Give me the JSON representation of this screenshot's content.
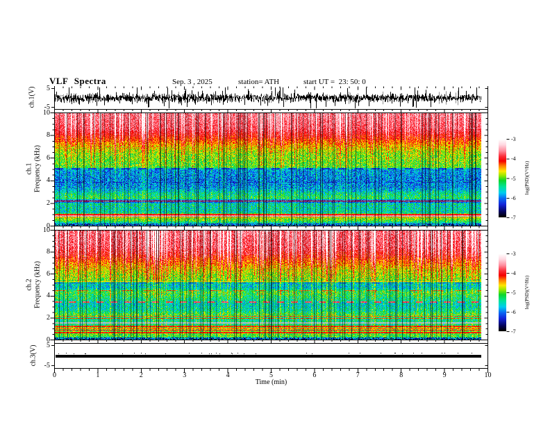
{
  "header": {
    "title": "VLF Spectra",
    "date": "Sep. 3 , 2025",
    "station": "station= ATH",
    "start_ut": "start UT =  23: 50: 0"
  },
  "axis": {
    "time_label": "Time (min)",
    "time_ticks": [
      "0",
      "1",
      "2",
      "3",
      "4",
      "5",
      "6",
      "7",
      "8",
      "9",
      "10"
    ],
    "freq_ticks": [
      "10",
      "8",
      "6",
      "4",
      "2",
      "0"
    ],
    "volt_ticks": [
      "5",
      "-5"
    ],
    "colorbar_ticks": [
      "-3",
      "-4",
      "-5",
      "-6",
      "-7"
    ],
    "colorbar_label": "log(PSD)(V²/Hz)"
  },
  "panel_labels": {
    "ch1_volt": "ch.1(V)",
    "ch1_name": "ch.1",
    "ch1_freq": "Frequency (kHz)",
    "ch2_name": "ch.2",
    "ch2_freq": "Frequency (kHz)",
    "ch3_volt": "ch.3(V)"
  },
  "colormap": {
    "stops": [
      [
        0,
        "#ffffff"
      ],
      [
        0.07,
        "#ffd9e2"
      ],
      [
        0.15,
        "#ff8d9e"
      ],
      [
        0.22,
        "#fb2e3a"
      ],
      [
        0.28,
        "#f40000"
      ],
      [
        0.34,
        "#ff7a00"
      ],
      [
        0.41,
        "#ffe800"
      ],
      [
        0.47,
        "#93e800"
      ],
      [
        0.53,
        "#0fd62a"
      ],
      [
        0.61,
        "#00e39a"
      ],
      [
        0.69,
        "#00cdf0"
      ],
      [
        0.76,
        "#0b6bf5"
      ],
      [
        0.84,
        "#1424d8"
      ],
      [
        0.93,
        "#04055e"
      ],
      [
        1,
        "#000000"
      ]
    ]
  },
  "chart_data": [
    {
      "type": "line",
      "panel": "ch.1 time series",
      "ylabel": "ch.1(V)",
      "xrange_min": [
        0,
        10
      ],
      "yrange_V": [
        -5,
        5
      ],
      "y_ticks_V": [
        5,
        -5
      ],
      "signal": "dense black broadband noise centered on 0 V, typical ±2 V, frequent spikes clipped near ±5 V",
      "data_end_min": 9.85,
      "render": {
        "seed": 7,
        "std_V": 1.0,
        "spike_prob": 0.1,
        "spike_gain": 3.0
      }
    },
    {
      "type": "heatmap",
      "panel": "ch.1 spectrogram",
      "ylabel": [
        "ch.1",
        "Frequency (kHz)"
      ],
      "xrange_min": [
        0,
        10
      ],
      "yrange_kHz": [
        0,
        10
      ],
      "y_ticks_kHz": [
        10,
        8,
        6,
        4,
        2,
        0
      ],
      "zlabel": "log(PSD)(V²/Hz)",
      "zrange_logPSD": [
        -7,
        -3
      ],
      "profile_f_level_sigma": [
        [
          0.0,
          -6.6,
          0.5
        ],
        [
          0.3,
          -5.4,
          0.5
        ],
        [
          0.5,
          -5.0,
          0.4
        ],
        [
          1.05,
          -5.0,
          0.45
        ],
        [
          1.15,
          -5.55,
          0.55
        ],
        [
          2.0,
          -5.55,
          0.55
        ],
        [
          2.1,
          -6.3,
          0.4
        ],
        [
          2.25,
          -6.3,
          0.4
        ],
        [
          2.4,
          -5.25,
          0.5
        ],
        [
          2.9,
          -5.5,
          0.55
        ],
        [
          3.3,
          -5.9,
          0.55
        ],
        [
          4.0,
          -6.05,
          0.55
        ],
        [
          5.0,
          -5.9,
          0.5
        ],
        [
          5.2,
          -5.05,
          0.45
        ],
        [
          6.4,
          -4.9,
          0.45
        ],
        [
          7.2,
          -4.5,
          0.4
        ],
        [
          8.0,
          -4.05,
          0.35
        ],
        [
          8.6,
          -3.8,
          0.3
        ],
        [
          10.0,
          -3.65,
          0.3
        ]
      ],
      "hlines_f_hw_level_dash": [
        [
          0.72,
          0.05,
          -4.45,
          0
        ],
        [
          0.88,
          0.06,
          -3.55,
          0
        ],
        [
          1.0,
          0.05,
          -4.1,
          0
        ],
        [
          2.18,
          0.05,
          -4.25,
          0
        ],
        [
          3.85,
          0.05,
          -6.4,
          14
        ],
        [
          5.05,
          0.06,
          -6.3,
          12
        ]
      ],
      "streaks": {
        "dark": 0.16,
        "darkAmp": 1.1,
        "bright": 0.22,
        "brightAmp": 0.85,
        "exp": 1.6
      },
      "dark_below_kHz": 0.18,
      "render": {
        "seed": 11
      }
    },
    {
      "type": "heatmap",
      "panel": "ch.2 spectrogram",
      "ylabel": [
        "ch.2",
        "Frequency (kHz)"
      ],
      "xrange_min": [
        0,
        10
      ],
      "yrange_kHz": [
        0,
        10
      ],
      "y_ticks_kHz": [
        10,
        8,
        6,
        4,
        2,
        0
      ],
      "zlabel": "log(PSD)(V²/Hz)",
      "zrange_logPSD": [
        -7,
        -3
      ],
      "profile_f_level_sigma": [
        [
          0.0,
          -6.6,
          0.5
        ],
        [
          0.25,
          -5.15,
          0.45
        ],
        [
          1.05,
          -4.95,
          0.5
        ],
        [
          1.3,
          -5.35,
          0.5
        ],
        [
          1.95,
          -5.45,
          0.5
        ],
        [
          2.3,
          -5.15,
          0.5
        ],
        [
          2.7,
          -5.5,
          0.5
        ],
        [
          3.3,
          -5.65,
          0.5
        ],
        [
          3.6,
          -5.45,
          0.5
        ],
        [
          4.35,
          -5.15,
          0.5
        ],
        [
          4.75,
          -5.7,
          0.5
        ],
        [
          5.15,
          -5.65,
          0.5
        ],
        [
          5.4,
          -5.0,
          0.45
        ],
        [
          6.3,
          -4.75,
          0.45
        ],
        [
          7.0,
          -4.4,
          0.4
        ],
        [
          7.8,
          -4.0,
          0.4
        ],
        [
          8.5,
          -3.8,
          0.35
        ],
        [
          10.0,
          -3.7,
          0.35
        ]
      ],
      "hlines_f_hw_level_dash": [
        [
          0.62,
          0.05,
          -4.15,
          0
        ],
        [
          0.85,
          0.05,
          -4.0,
          0
        ],
        [
          1.02,
          0.04,
          -4.4,
          0
        ],
        [
          1.22,
          0.05,
          -4.2,
          0
        ],
        [
          1.52,
          0.06,
          null,
          0,
          "gray"
        ],
        [
          1.95,
          0.05,
          -4.3,
          0
        ],
        [
          2.12,
          0.04,
          -4.35,
          0
        ],
        [
          3.42,
          0.06,
          -3.8,
          10
        ],
        [
          4.5,
          0.05,
          -4.3,
          16
        ],
        [
          5.18,
          0.05,
          -6.2,
          12
        ],
        [
          5.32,
          0.04,
          -4.6,
          0
        ]
      ],
      "streaks": {
        "dark": 0.17,
        "darkAmp": 1.0,
        "bright": 0.26,
        "brightAmp": 1.0,
        "exp": 1.3
      },
      "dark_below_kHz": 0.18,
      "render": {
        "seed": 23
      }
    },
    {
      "type": "line",
      "panel": "ch.3 time series",
      "ylabel": "ch.3(V)",
      "xrange_min": [
        0,
        10
      ],
      "yrange_V": [
        -5,
        5
      ],
      "y_ticks_V": [
        5,
        -5
      ],
      "signal": "flat thick black trace just below 0 V, no activity",
      "value_V": -0.3,
      "data_end_min": 9.85,
      "render": {
        "seed": 31,
        "speck_prob": 0.05
      }
    }
  ]
}
